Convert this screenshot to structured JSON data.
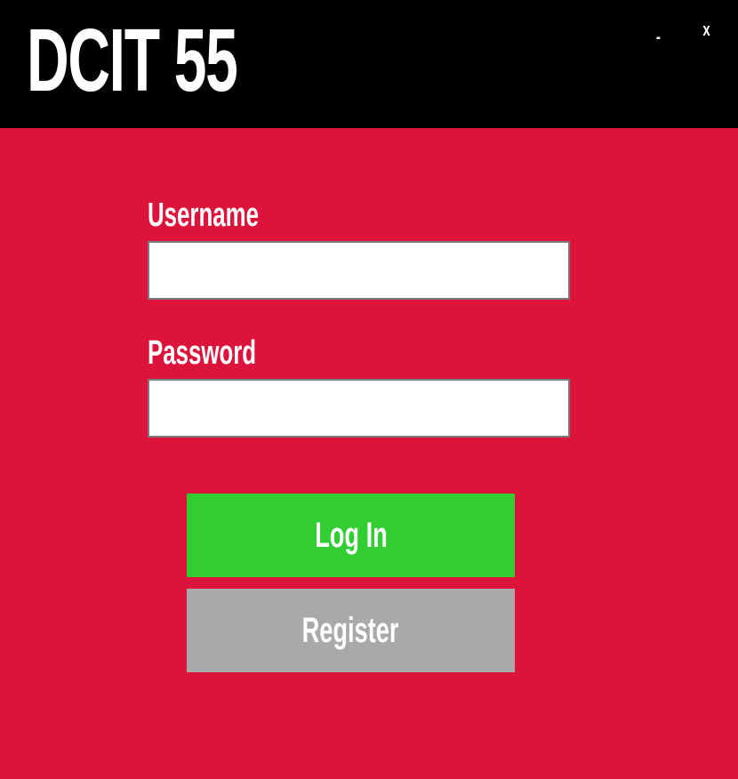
{
  "app": {
    "title": "DCIT 55",
    "minimize_label": "-",
    "close_label": "x"
  },
  "form": {
    "username_label": "Username",
    "username_value": "",
    "password_label": "Password",
    "password_value": "",
    "login_label": "Log In",
    "register_label": "Register"
  },
  "colors": {
    "background": "#DC143C",
    "titlebar": "#000000",
    "login_button": "#32CD32",
    "register_button": "#A9A9A9",
    "text": "#FFFFFF"
  }
}
